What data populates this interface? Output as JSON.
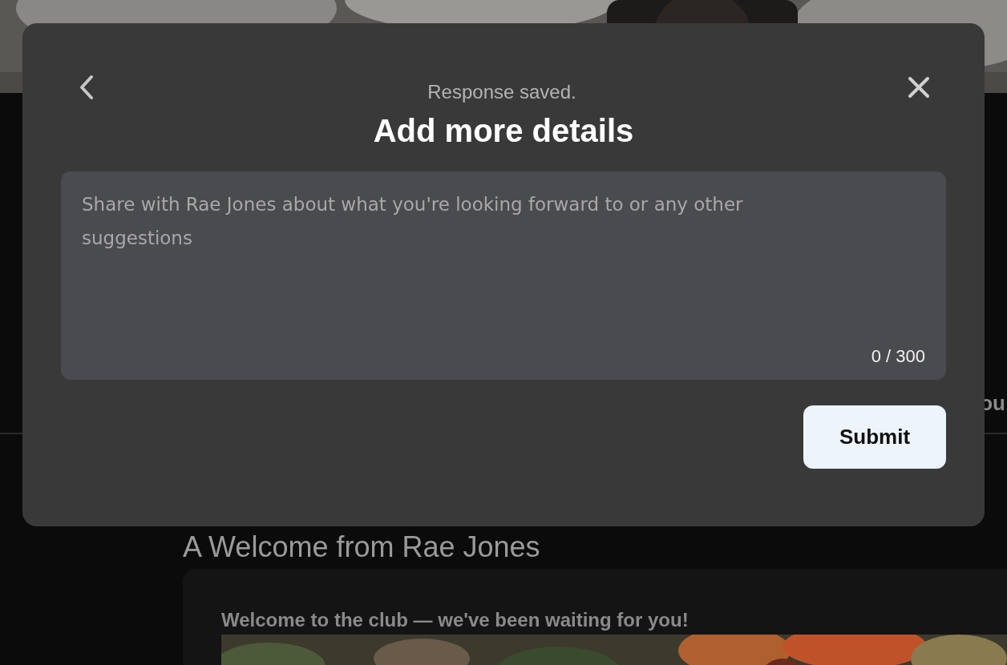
{
  "background": {
    "heading": "A Welcome from Rae Jones",
    "side_text": "ou",
    "card": {
      "title": "Welcome to the club — we've been waiting for you!"
    }
  },
  "dialog": {
    "status": "Response saved.",
    "title": "Add more details",
    "details_field": {
      "placeholder": "Share with Rae Jones about what you're looking forward to or any other suggestions",
      "counter": "0 / 300"
    },
    "submit": "Submit"
  }
}
